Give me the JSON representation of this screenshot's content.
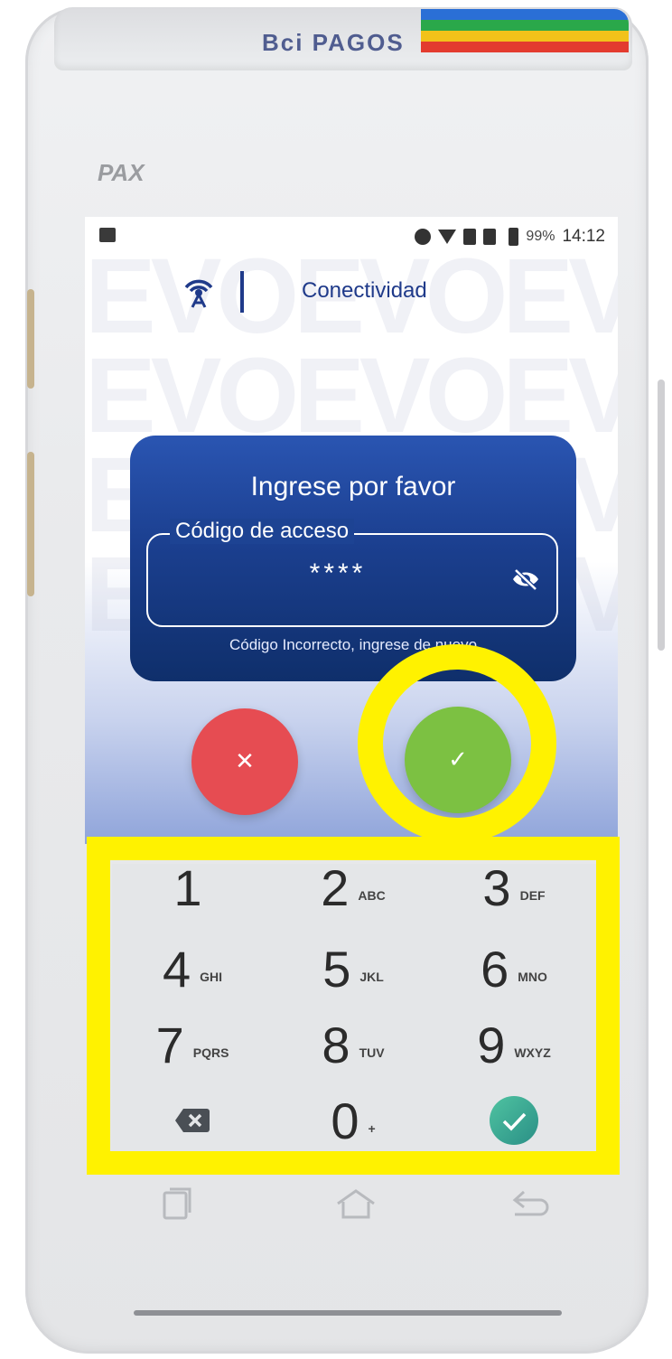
{
  "status_bar": {
    "battery": "99%",
    "time": "14:12"
  },
  "header": {
    "title": "Conectividad",
    "icon": "wifi-antenna-icon"
  },
  "dialog": {
    "title": "Ingrese por favor",
    "field_label": "Código de acceso",
    "field_value": "****",
    "message": "Código Incorrecto, ingrese de nuevo",
    "cancel_glyph": "✕",
    "confirm_glyph": "✓"
  },
  "keypad": {
    "keys": [
      {
        "num": "1",
        "letters": ""
      },
      {
        "num": "2",
        "letters": "ABC"
      },
      {
        "num": "3",
        "letters": "DEF"
      },
      {
        "num": "4",
        "letters": "GHI"
      },
      {
        "num": "5",
        "letters": "JKL"
      },
      {
        "num": "6",
        "letters": "MNO"
      },
      {
        "num": "7",
        "letters": "PQRS"
      },
      {
        "num": "8",
        "letters": "TUV"
      },
      {
        "num": "9",
        "letters": "WXYZ"
      },
      {
        "num": "0",
        "letters": "+"
      }
    ]
  },
  "colors": {
    "accent_blue": "#1f3a8a",
    "cancel_red": "#e64c52",
    "confirm_green": "#7cc142",
    "highlight_yellow": "#fff200",
    "key_ok_teal": "#3aa98c"
  }
}
